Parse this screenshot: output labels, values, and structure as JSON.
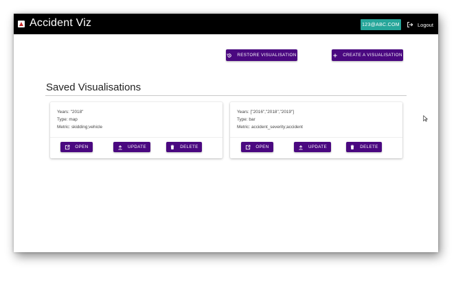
{
  "app": {
    "title": "Accident Viz",
    "user_email": "123@ABC.COM",
    "logout_label": "Logout"
  },
  "toolbar": {
    "restore_label": "RESTORE VISUALISATION",
    "create_label": "CREATE A VISUALISATION"
  },
  "section": {
    "title": "Saved Visualisations"
  },
  "cards": [
    {
      "years": "Years: \"2018\"",
      "type": "Type: map",
      "metric": "Metric: skidding;vehicle",
      "open_label": "OPEN",
      "update_label": "UPDATE",
      "delete_label": "DELETE"
    },
    {
      "years": "Years: [\"2016\",\"2018\",\"2019\"]",
      "type": "Type: bar",
      "metric": "Metric: accident_severity;accident",
      "open_label": "OPEN",
      "update_label": "UPDATE",
      "delete_label": "DELETE"
    }
  ],
  "colors": {
    "appbar": "#000000",
    "primary": "#4a0880",
    "user_chip": "#26a69a"
  }
}
